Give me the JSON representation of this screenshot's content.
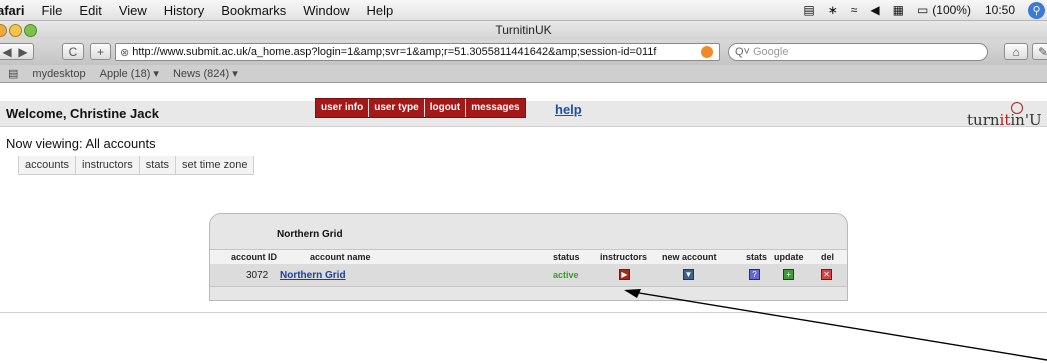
{
  "menubar": {
    "app": "afari",
    "items": [
      "File",
      "Edit",
      "View",
      "History",
      "Bookmarks",
      "Window",
      "Help"
    ],
    "battery": "(100%)",
    "clock": "10:50"
  },
  "window": {
    "title": "TurnitinUK"
  },
  "toolbar": {
    "reload": "C",
    "add": "+",
    "url": "http://www.submit.ac.uk/a_home.asp?login=1&amp;svr=1&amp;r=51.3055811441642&amp;session-id=011f",
    "search_placeholder": "Google"
  },
  "bookmarks": [
    "mydesktop",
    "Apple (18) ▾",
    "News (824) ▾"
  ],
  "header": {
    "welcome": "Welcome, Christine Jack",
    "menu": [
      "user info",
      "user type",
      "logout",
      "messages"
    ],
    "help": "help"
  },
  "logo": {
    "pre": "turn",
    "mid": "it",
    "post": "in'U"
  },
  "now_viewing": "Now viewing: All accounts",
  "tabs": [
    "accounts",
    "instructors",
    "stats",
    "set time zone"
  ],
  "panel": {
    "title": "Northern Grid",
    "columns": [
      "account ID",
      "account name",
      "status",
      "instructors",
      "new account",
      "stats",
      "update",
      "del"
    ],
    "rows": [
      {
        "account_id": "3072",
        "account_name": "Northern Grid",
        "status": "active"
      }
    ]
  },
  "colors": {
    "menu_red": "#a51818",
    "link_blue": "#1a3fa0",
    "active_green": "#3c9a2c"
  },
  "icons": {
    "instructors": "instructors-icon",
    "new_account": "new-account-icon",
    "stats": "stats-icon",
    "update": "update-icon",
    "del": "delete-icon"
  }
}
